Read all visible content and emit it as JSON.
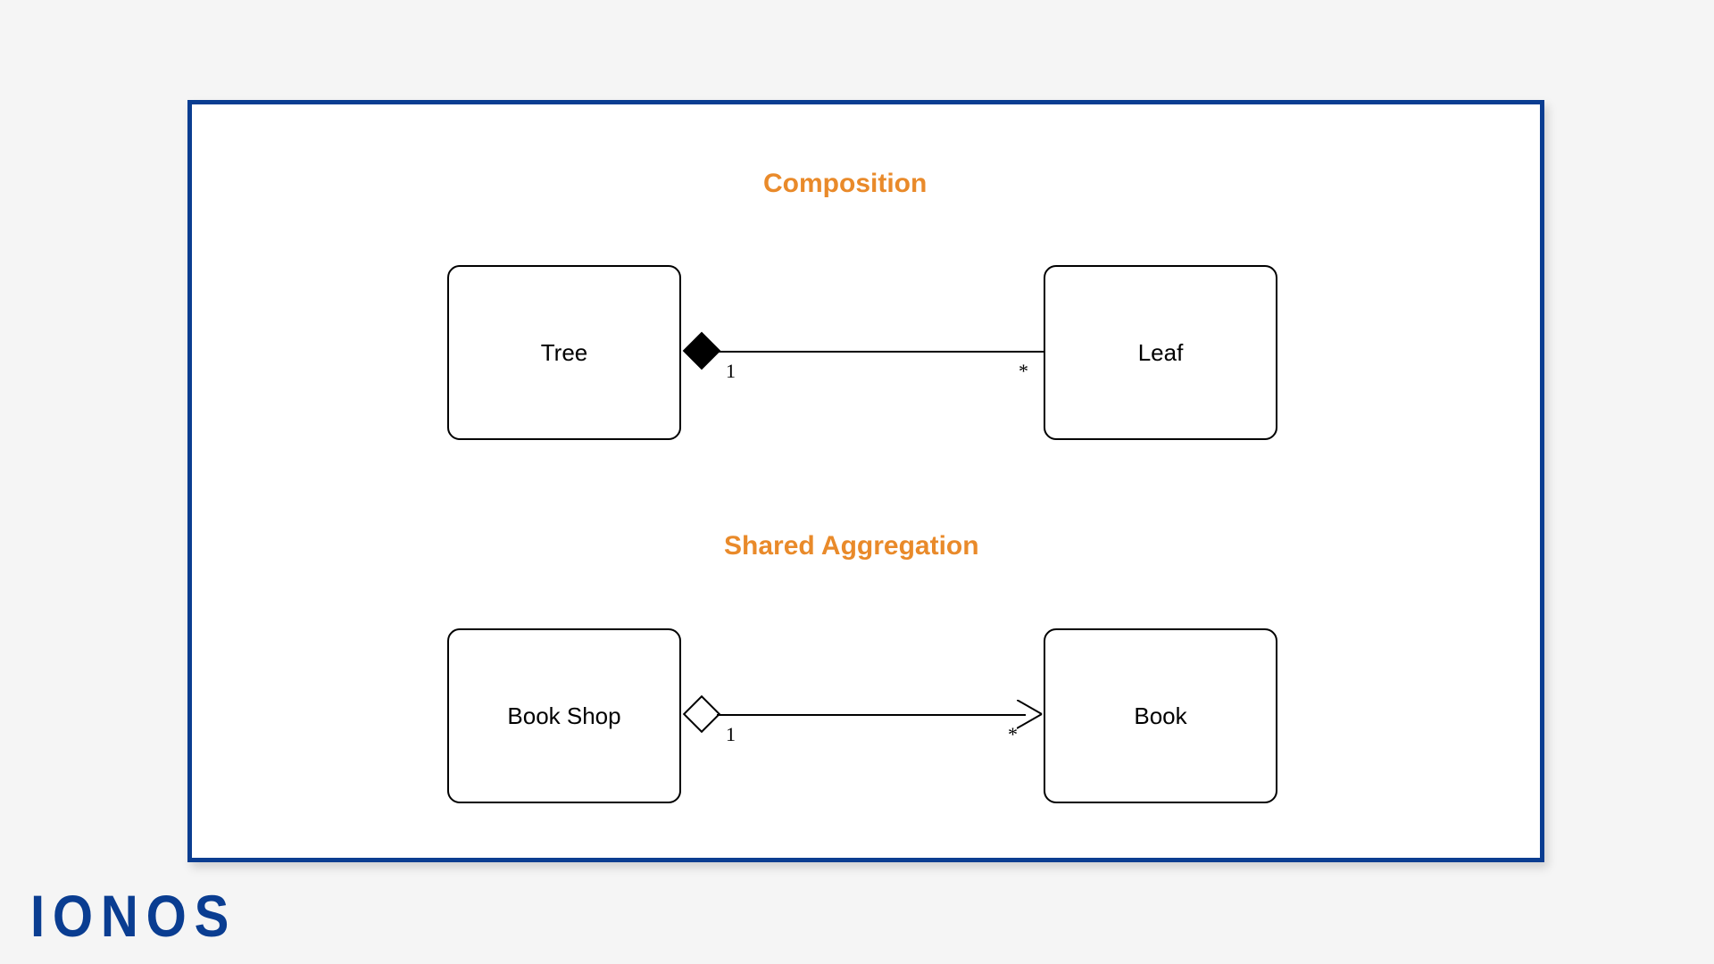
{
  "brand": "IONOS",
  "diagram": {
    "sections": [
      {
        "title": "Composition",
        "relation": "composition",
        "left_class": "Tree",
        "right_class": "Leaf",
        "left_multiplicity": "1",
        "right_multiplicity": "*",
        "diamond_fill": "filled",
        "arrow_at_right": false
      },
      {
        "title": "Shared Aggregation",
        "relation": "aggregation",
        "left_class": "Book Shop",
        "right_class": "Book",
        "left_multiplicity": "1",
        "right_multiplicity": "*",
        "diamond_fill": "hollow",
        "arrow_at_right": true
      }
    ]
  }
}
